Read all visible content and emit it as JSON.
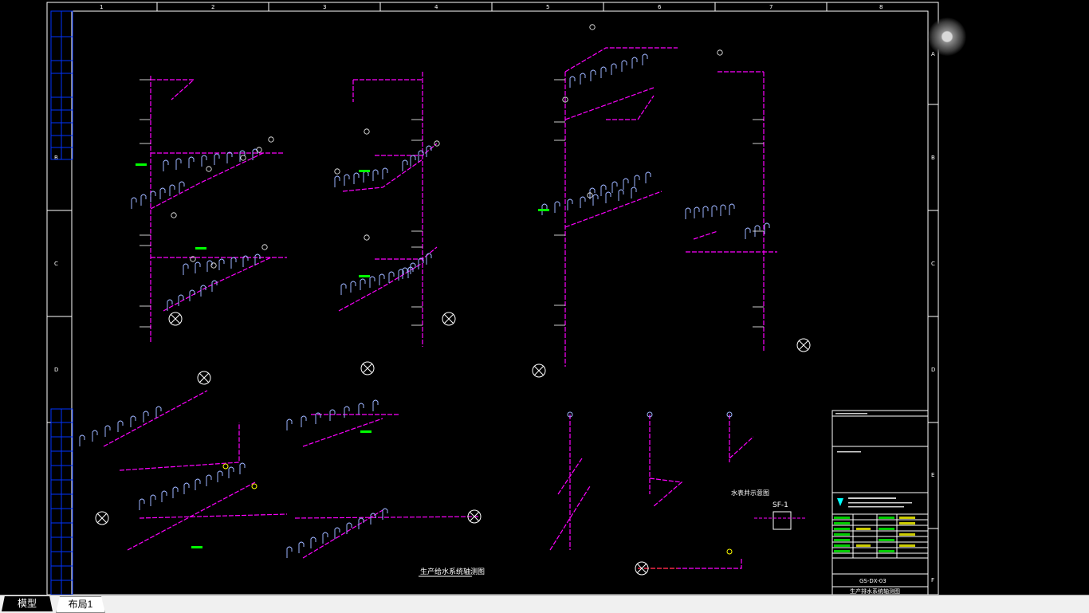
{
  "tabs": [
    {
      "label": "模型"
    },
    {
      "label": "布局1"
    }
  ],
  "border": {
    "col_labels": [
      "1",
      "2",
      "3",
      "4",
      "5",
      "6",
      "7",
      "8"
    ],
    "row_labels": [
      "A",
      "B",
      "C",
      "D",
      "E",
      "F"
    ]
  },
  "drawing": {
    "caption_supply": "生产给水系统轴测图",
    "caption_drain": "生产排水系统轴测图",
    "water_meter_label": "水表井示意图",
    "sf_label": "SF-1"
  },
  "title_block": {
    "drawing_number": "GS-DX-03",
    "drawing_title": "生产排水系统轴测图"
  },
  "colors": {
    "frame": "#ffffff",
    "pipe": "#ff00ff",
    "fixture": "#9db4ff",
    "marker": "#ffffff",
    "accent_green": "#00ff00",
    "accent_yellow": "#ffff00",
    "accent_red": "#ff3030",
    "panel_blue": "#0033ff"
  },
  "icons": {
    "nav": "navigation-wheel-icon"
  }
}
